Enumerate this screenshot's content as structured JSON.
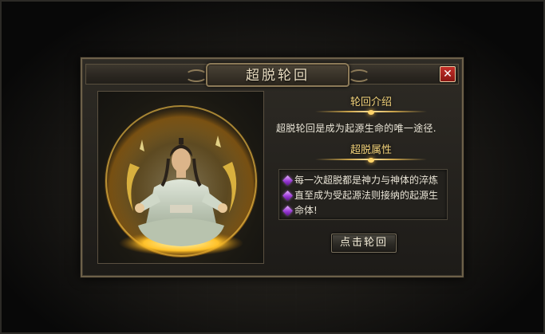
{
  "dialog": {
    "title": "超脱轮回",
    "close_glyph": "✕"
  },
  "intro": {
    "heading": "轮回介绍",
    "text": "超脱轮回是成为起源生命的唯一途径."
  },
  "attributes": {
    "heading": "超脱属性",
    "lines": [
      "每一次超脱都是神力与神体的淬炼",
      "直至成为受起源法则接纳的起源生",
      "命体!"
    ],
    "bullet_icon": "purple-gem-icon"
  },
  "action": {
    "label": "点击轮回"
  },
  "portrait": {
    "subject": "meditating-hero-in-golden-orb"
  },
  "colors": {
    "heading": "#f2d27a",
    "body_text": "#e9e4d6",
    "close": "#c4302a",
    "frame": "#6c6049"
  }
}
